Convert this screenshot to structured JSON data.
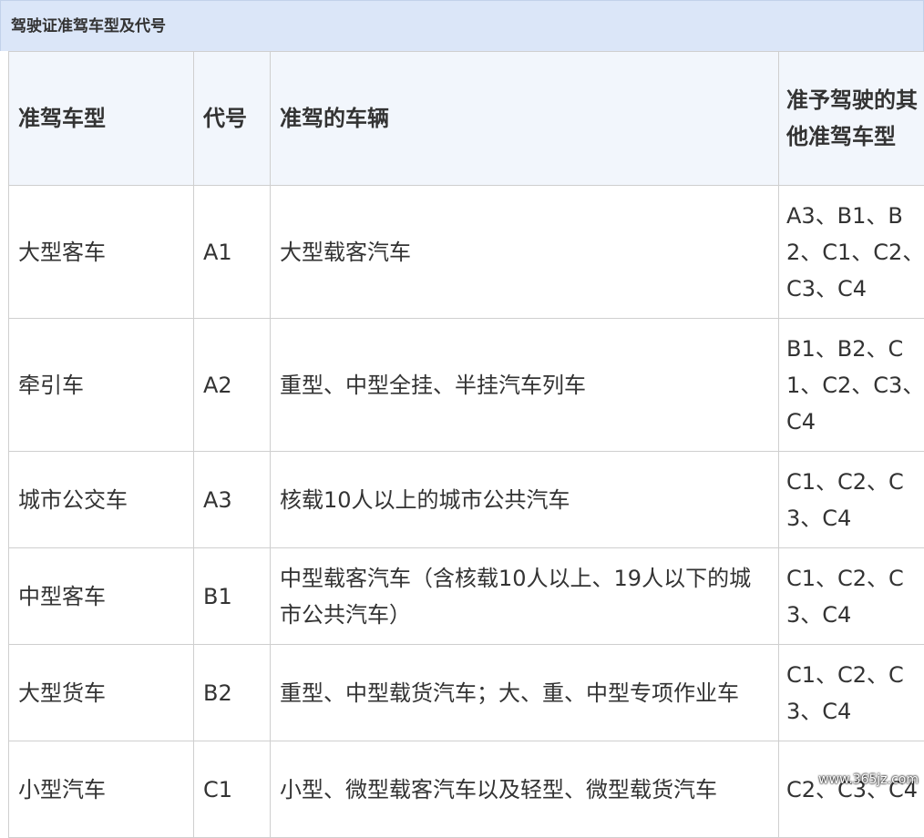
{
  "caption": "驾驶证准驾车型及代号",
  "table": {
    "headers": [
      "准驾车型",
      "代号",
      "准驾的车辆",
      "准予驾驶的其他准驾车型"
    ],
    "rows": [
      [
        "大型客车",
        "A1",
        "大型载客汽车",
        "A3、B1、B2、C1、C2、C3、C4"
      ],
      [
        "牵引车",
        "A2",
        "重型、中型全挂、半挂汽车列车",
        "B1、B2、C1、C2、C3、C4"
      ],
      [
        "城市公交车",
        "A3",
        "核载10人以上的城市公共汽车",
        "C1、C2、C3、C4"
      ],
      [
        "中型客车",
        "B1",
        "中型载客汽车（含核载10人以上、19人以下的城市公共汽车）",
        "C1、C2、C3、C4"
      ],
      [
        "大型货车",
        "B2",
        "重型、中型载货汽车；大、重、中型专项作业车",
        "C1、C2、C3、C4"
      ],
      [
        "小型汽车",
        "C1",
        "小型、微型载客汽车以及轻型、微型载货汽车",
        "C2、C3、C4"
      ]
    ]
  },
  "watermark": "www.365jz.com"
}
